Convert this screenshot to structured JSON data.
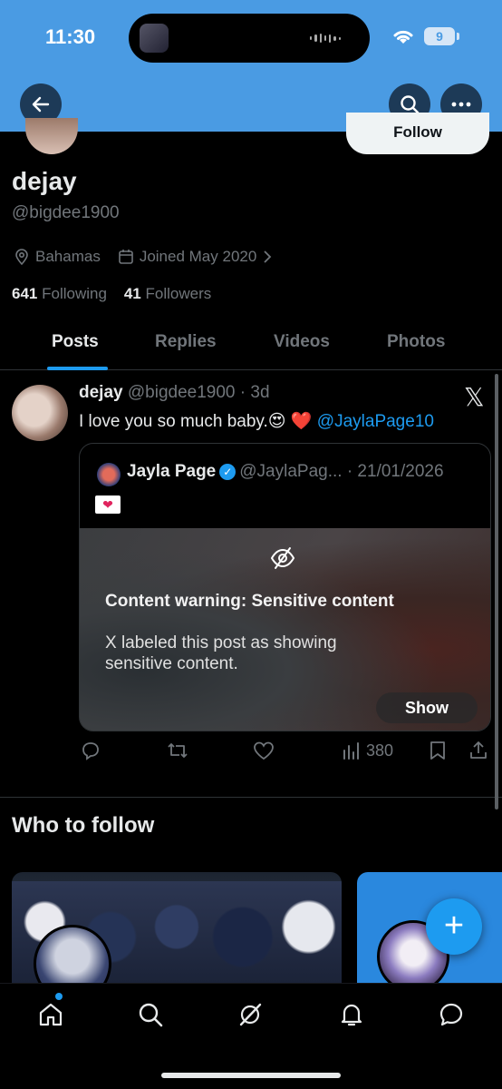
{
  "status_bar": {
    "time": "11:30",
    "battery": "9"
  },
  "profile": {
    "follow_label": "Follow",
    "display_name": "dejay",
    "handle": "@bigdee1900",
    "location": "Bahamas",
    "joined": "Joined May 2020",
    "following_count": "641",
    "following_label": "Following",
    "followers_count": "41",
    "followers_label": "Followers"
  },
  "tabs": [
    {
      "label": "Posts",
      "active": true
    },
    {
      "label": "Replies",
      "active": false
    },
    {
      "label": "Videos",
      "active": false
    },
    {
      "label": "Photos",
      "active": false
    }
  ],
  "post": {
    "author_name": "dejay",
    "author_handle": "@bigdee1900",
    "time": "· 3d",
    "text": "I love you so much baby.😍 ❤️",
    "mention": "@JaylaPage10",
    "x_logo": "𝕏",
    "quote": {
      "author_name": "Jayla Page",
      "author_handle": "@JaylaPag...",
      "date": "· 21/01/2026",
      "emoji": "❤",
      "warning_title": "Content warning: Sensitive content",
      "warning_body": "X labeled this post as showing sensitive content.",
      "show_label": "Show"
    },
    "views": "380"
  },
  "who_to_follow": {
    "title": "Who to follow"
  },
  "fab_label": "+",
  "icons": [
    "back-icon",
    "search-icon",
    "more-icon",
    "location-icon",
    "calendar-icon",
    "chevron-right-icon",
    "eye-slash-icon",
    "reply-icon",
    "repost-icon",
    "like-icon",
    "views-icon",
    "bookmark-icon",
    "share-icon",
    "home-icon",
    "grok-icon",
    "notifications-icon",
    "messages-icon"
  ],
  "colors": {
    "accent": "#1d9bf0",
    "banner": "#4a9be3",
    "background": "#000000",
    "secondary_text": "#71767b"
  }
}
